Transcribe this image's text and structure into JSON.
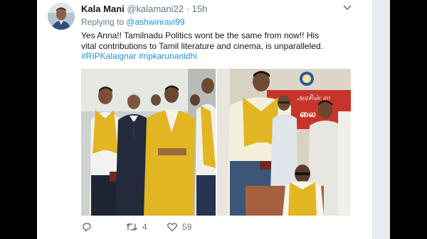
{
  "tweet": {
    "author_name": "Kala Mani",
    "handle": "@kalamani22",
    "separator": "·",
    "time": "15h",
    "reply_prefix": "Replying to",
    "reply_to": "@ashwinravi99",
    "text_line1": "Yes Anna!! Tamilnadu Politics wont be the same from now!! His",
    "text_line2": "vital contributions to Tamil literature and cinema, is unparalleled.",
    "hashtag1": "#RIPKalaignar",
    "hashtag2": "#ripkarunanidhi",
    "retweet_count": "4",
    "like_count": "59"
  },
  "photo_right": {
    "banner_line1": "அரசின் சா",
    "banner_line2": "லை"
  },
  "icons": {
    "menu": "chevron-down-icon",
    "reply": "reply-icon",
    "retweet": "retweet-icon",
    "like": "heart-icon"
  },
  "colors": {
    "link": "#1b95e0",
    "secondary_text": "#657786",
    "primary_text": "#14171a",
    "shawl_gold": "#e2b622",
    "stage_backdrop": "#c7342b"
  }
}
